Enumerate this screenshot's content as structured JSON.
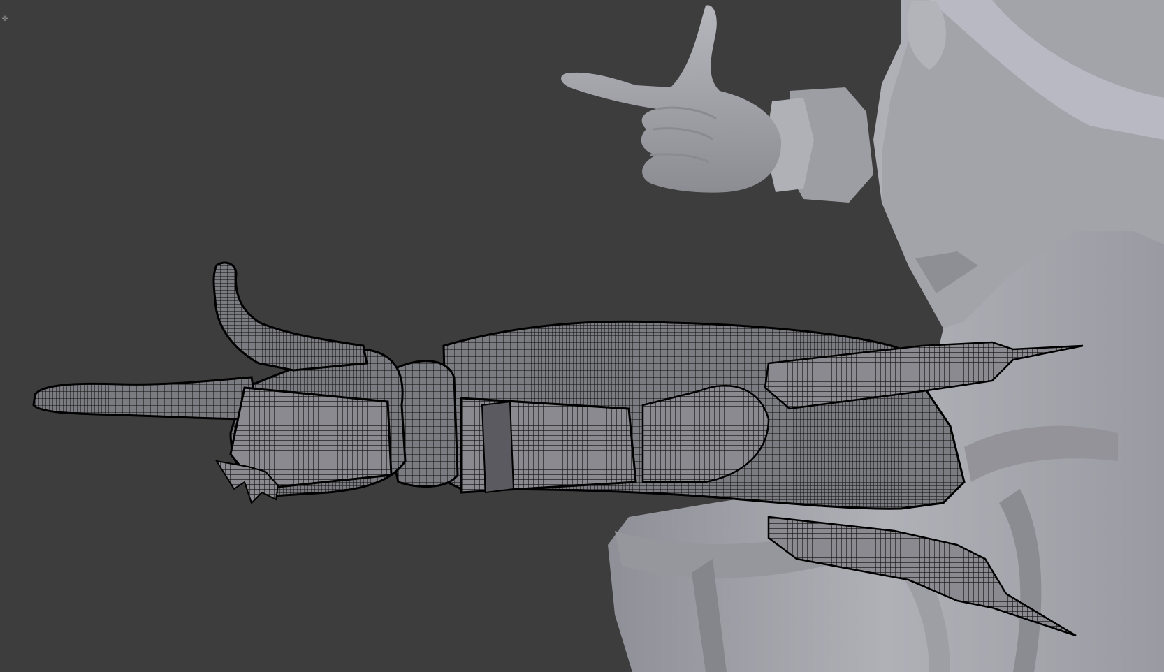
{
  "viewport": {
    "background_color": "#3d3d3d",
    "wire_color": "#111111",
    "solid_color": "#a9a9b0",
    "shade_color": "#7f7f86",
    "corner_icons": [
      "area-split-icon",
      "area-split-icon"
    ]
  }
}
